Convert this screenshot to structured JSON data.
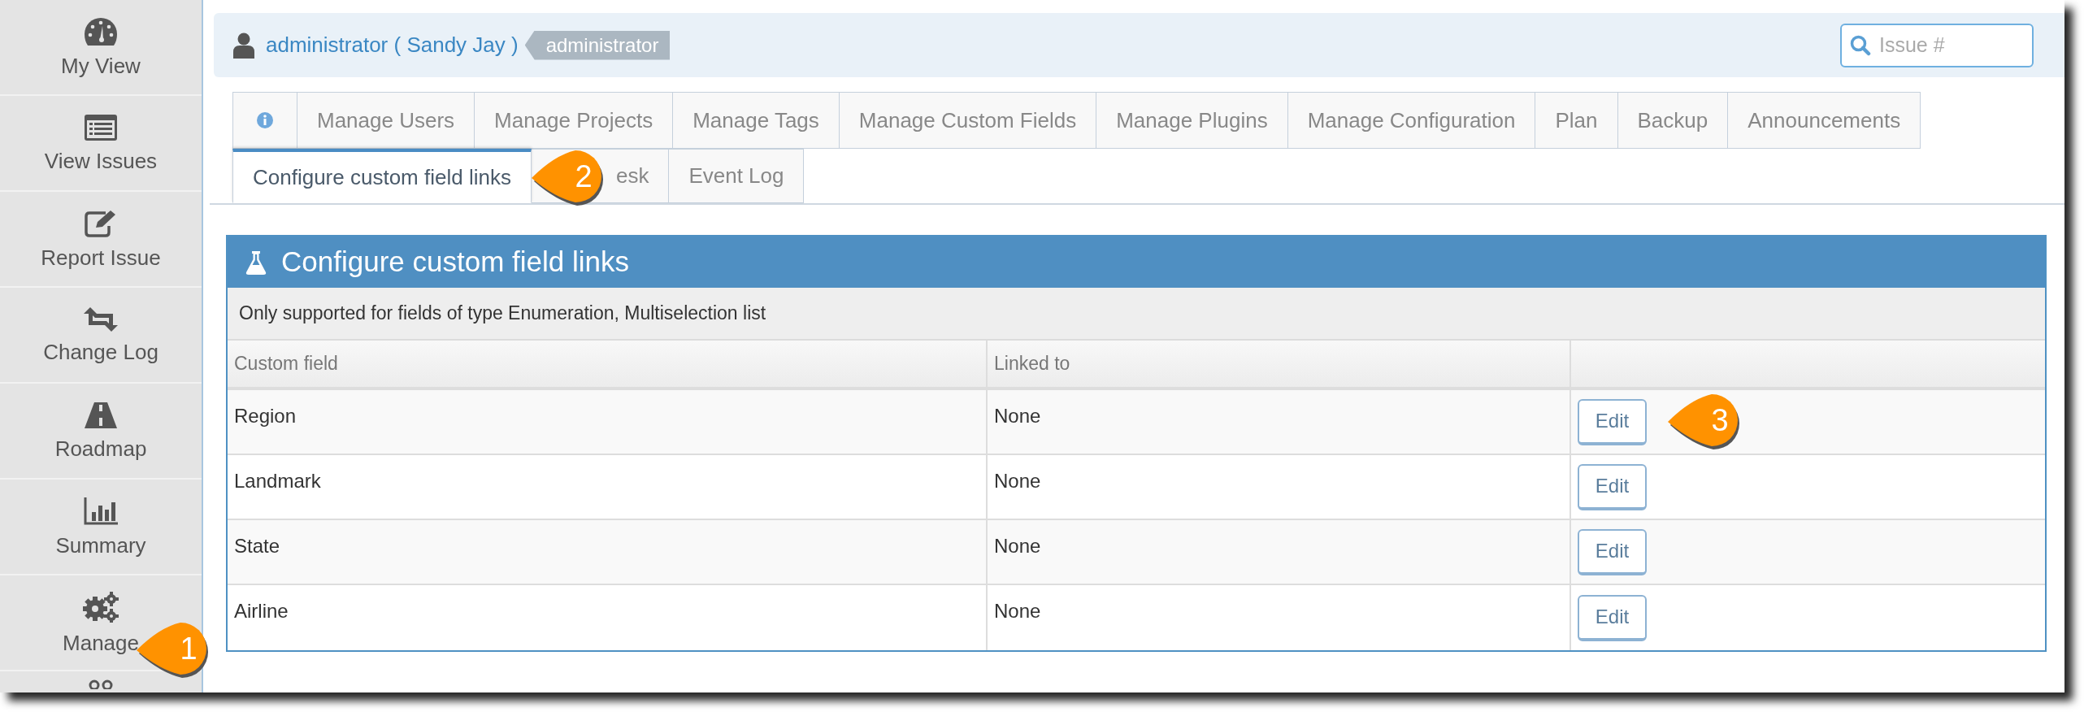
{
  "sidebar": {
    "items": [
      {
        "label": "My View"
      },
      {
        "label": "View Issues"
      },
      {
        "label": "Report Issue"
      },
      {
        "label": "Change Log"
      },
      {
        "label": "Roadmap"
      },
      {
        "label": "Summary"
      },
      {
        "label": "Manage"
      }
    ]
  },
  "user": {
    "name": "administrator ( Sandy Jay )",
    "role": "administrator"
  },
  "search": {
    "placeholder": "Issue #"
  },
  "tabs": [
    [
      {
        "kind": "icon",
        "selected": false
      },
      {
        "kind": "text",
        "label": "Manage Users",
        "selected": false
      },
      {
        "kind": "text",
        "label": "Manage Projects",
        "selected": false
      },
      {
        "kind": "text",
        "label": "Manage Tags",
        "selected": false
      },
      {
        "kind": "text",
        "label": "Manage Custom Fields",
        "selected": false
      },
      {
        "kind": "text",
        "label": "Manage Plugins",
        "selected": false
      },
      {
        "kind": "text",
        "label": "Manage Configuration",
        "selected": false
      },
      {
        "kind": "text",
        "label": "Plan",
        "selected": false
      },
      {
        "kind": "text",
        "label": "Backup",
        "selected": false
      },
      {
        "kind": "text",
        "label": "Announcements",
        "selected": false
      }
    ],
    [
      {
        "kind": "text",
        "label": "Configure custom field links",
        "selected": true
      },
      {
        "kind": "text",
        "label": "esk",
        "selected": false
      },
      {
        "kind": "text",
        "label": "Event Log",
        "selected": false
      }
    ]
  ],
  "panel": {
    "title": "Configure custom field links",
    "note": "Only supported for fields of type Enumeration, Multiselection list",
    "columns": [
      "Custom field",
      "Linked to"
    ],
    "rows": [
      {
        "custom_field": "Region",
        "linked_to": "None",
        "action": "Edit"
      },
      {
        "custom_field": "Landmark",
        "linked_to": "None",
        "action": "Edit"
      },
      {
        "custom_field": "State",
        "linked_to": "None",
        "action": "Edit"
      },
      {
        "custom_field": "Airline",
        "linked_to": "None",
        "action": "Edit"
      }
    ]
  },
  "callouts": [
    "1",
    "2",
    "3"
  ]
}
